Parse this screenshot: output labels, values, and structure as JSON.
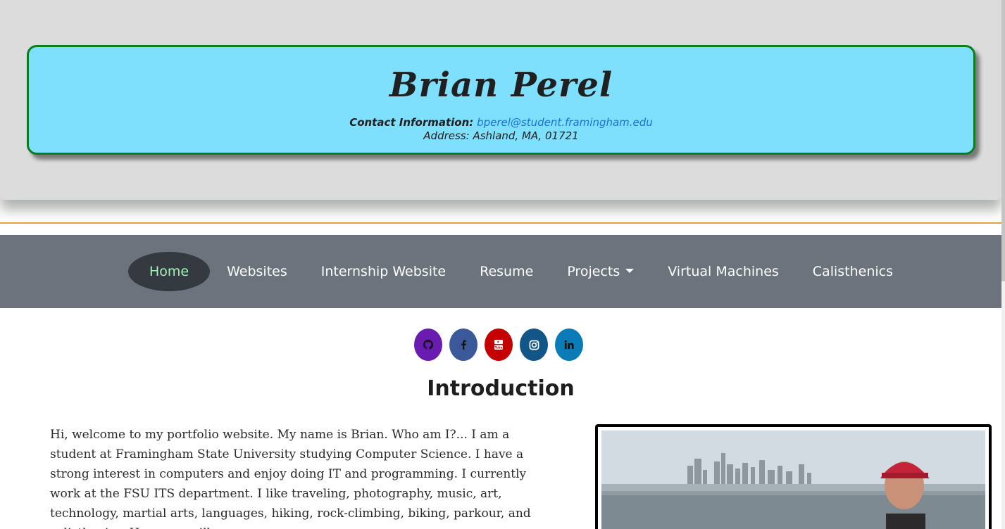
{
  "header": {
    "name": "Brian Perel",
    "contact_label": "Contact Information:",
    "email": "bperel@student.framingham.edu",
    "address": "Address: Ashland, MA, 01721"
  },
  "nav": {
    "items": [
      {
        "label": "Home"
      },
      {
        "label": "Websites"
      },
      {
        "label": "Internship Website"
      },
      {
        "label": "Resume"
      },
      {
        "label": "Projects"
      },
      {
        "label": "Virtual Machines"
      },
      {
        "label": "Calisthenics"
      }
    ]
  },
  "socials": [
    {
      "icon": "github-icon",
      "color": "#6a1bb0"
    },
    {
      "icon": "facebook-icon",
      "color": "#3b5998"
    },
    {
      "icon": "youtube-icon",
      "color": "#c40000"
    },
    {
      "icon": "instagram-icon",
      "color": "#125688"
    },
    {
      "icon": "linkedin-icon",
      "color": "#0b7bb8"
    }
  ],
  "main": {
    "title": "Introduction",
    "intro": "Hi, welcome to my portfolio website. My name is Brian. Who am I?... I am a student at Framingham State University studying Computer Science. I have a strong interest in computers and enjoy doing IT and programming. I currently work at the FSU ITS department. I like traveling, photography, music, art, technology, martial arts, languages, hiking, rock-climbing, biking, parkour, and calisthenics. Here you will"
  },
  "colors": {
    "header_card": "#7fe0fe",
    "header_border": "#0b7d1c",
    "navbar": "#6c737c",
    "nav_active_bg": "#343a40",
    "nav_active_text": "#a4f2b8",
    "email_link": "#1a6fd8",
    "divider": "#e0a43a"
  }
}
